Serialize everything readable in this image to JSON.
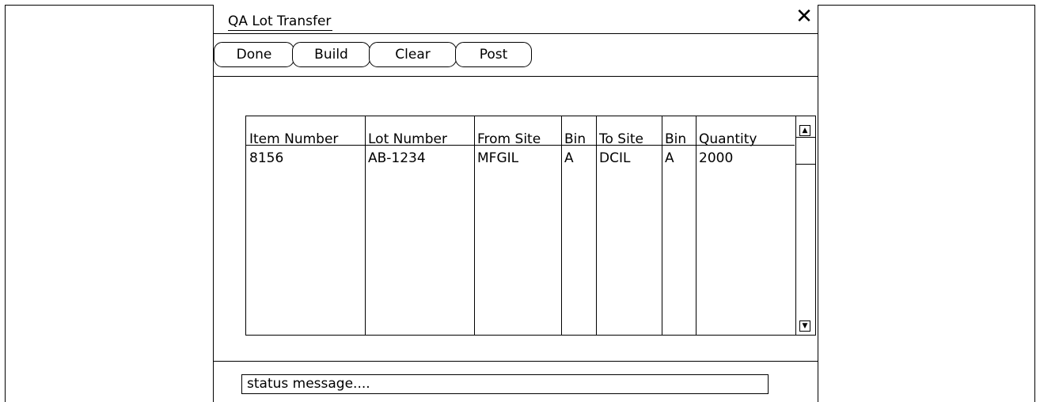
{
  "window": {
    "title": "QA Lot Transfer",
    "close_glyph": "✕"
  },
  "toolbar": {
    "buttons": [
      {
        "label": "Done"
      },
      {
        "label": "Build"
      },
      {
        "label": "Clear"
      },
      {
        "label": "Post"
      }
    ]
  },
  "grid": {
    "columns": [
      "Item Number",
      "Lot Number",
      "From Site",
      "Bin",
      "To Site",
      "Bin",
      "Quantity"
    ],
    "rows": [
      [
        "8156",
        "AB-1234",
        "MFGIL",
        "A",
        "DCIL",
        "A",
        "2000"
      ]
    ],
    "scroll_up_glyph": "▲",
    "scroll_down_glyph": "▼"
  },
  "status": {
    "message": "status message...."
  }
}
